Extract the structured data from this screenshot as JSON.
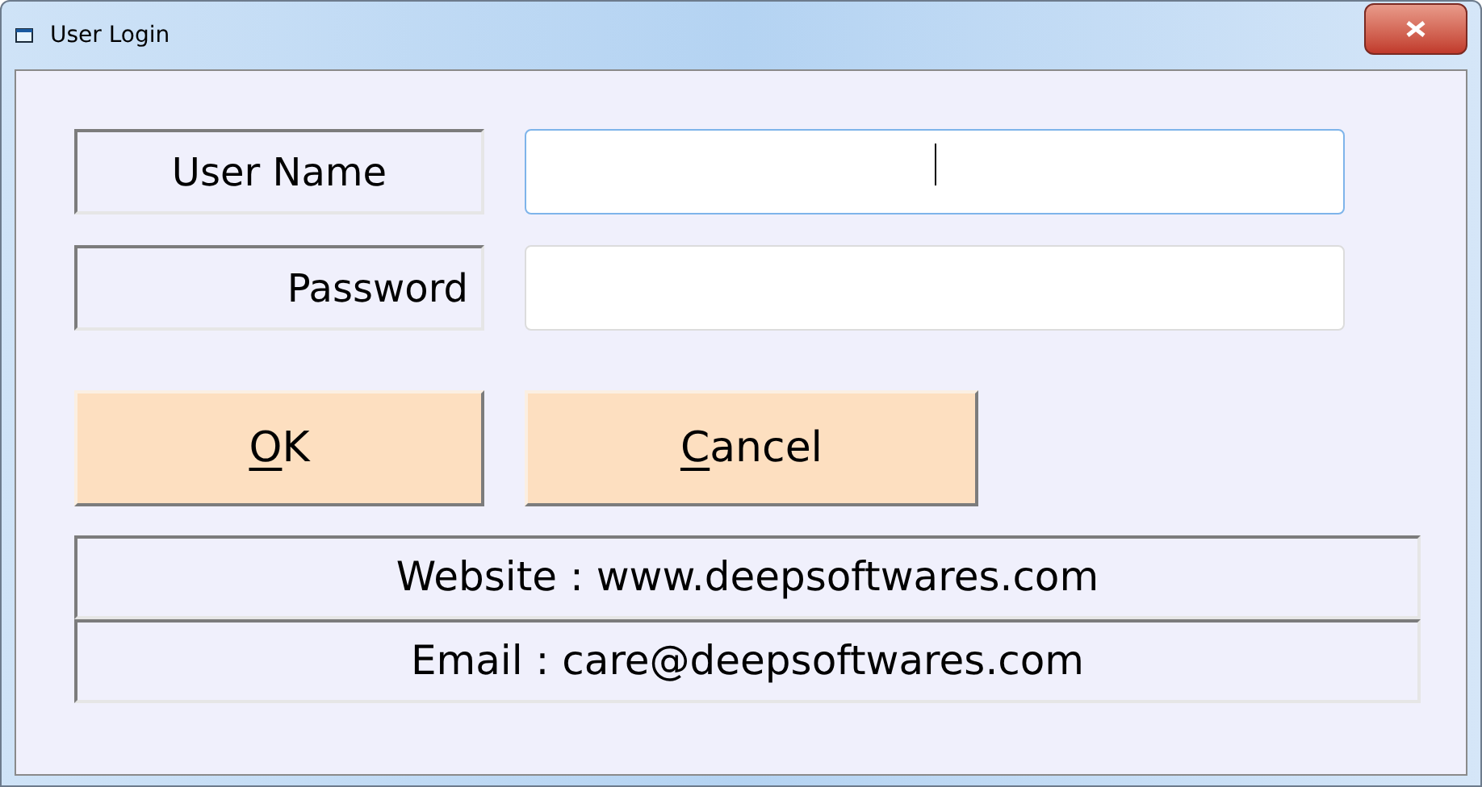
{
  "window": {
    "title": "User Login"
  },
  "fields": [
    {
      "label": "User Name",
      "kind": "centered",
      "focused": true
    },
    {
      "label": "Password",
      "kind": "trailing",
      "focused": false
    }
  ],
  "buttons": [
    {
      "label": "OK"
    },
    {
      "label": "Cancel"
    }
  ],
  "info": [
    "Website : www.deepsoftwares.com",
    "Email : care@deepsoftwares.com"
  ]
}
